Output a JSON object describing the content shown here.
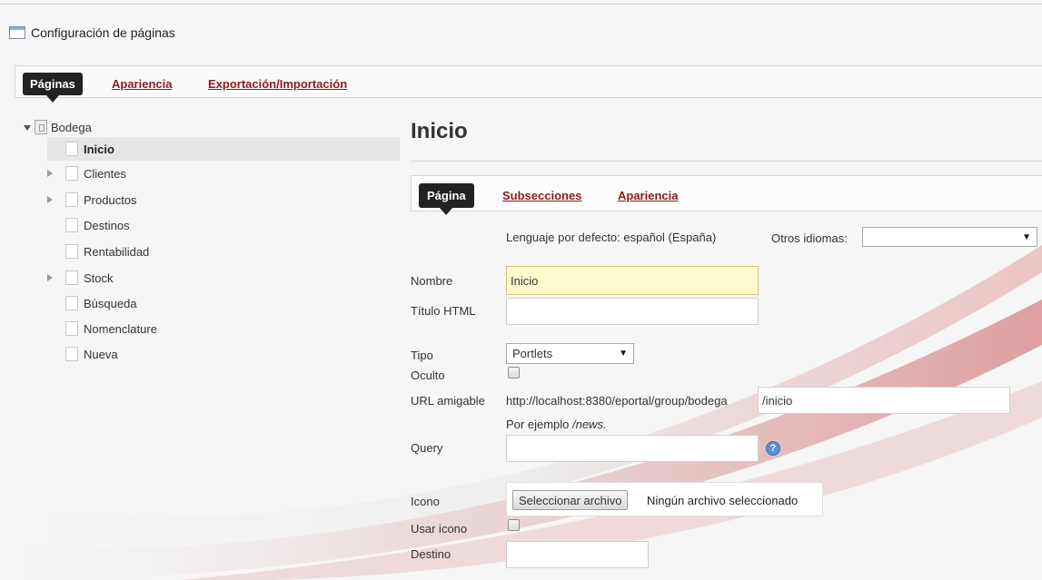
{
  "page": {
    "title": "Configuración de páginas"
  },
  "main_tabs": [
    {
      "label": "Páginas",
      "active": true
    },
    {
      "label": "Apariencia",
      "active": false
    },
    {
      "label": "Exportación/Importación",
      "active": false
    }
  ],
  "tree": {
    "root": "Bodega",
    "items": [
      {
        "label": "Inicio",
        "selected": true,
        "expandable": false
      },
      {
        "label": "Clientes",
        "expandable": true
      },
      {
        "label": "Productos",
        "expandable": true
      },
      {
        "label": "Destinos",
        "expandable": false
      },
      {
        "label": "Rentabilidad",
        "expandable": false
      },
      {
        "label": "Stock",
        "expandable": true
      },
      {
        "label": "Búsqueda",
        "expandable": false
      },
      {
        "label": "Nomenclature",
        "expandable": false
      },
      {
        "label": "Nueva",
        "expandable": false
      }
    ]
  },
  "detail": {
    "heading": "Inicio",
    "tabs": [
      {
        "label": "Página",
        "active": true
      },
      {
        "label": "Subsecciones",
        "active": false
      },
      {
        "label": "Apariencia",
        "active": false
      }
    ],
    "language": {
      "default_text": "Lenguaje por defecto: español (España)",
      "other_label": "Otros idiomas:",
      "other_value": ""
    },
    "form": {
      "nombre_label": "Nombre",
      "nombre_value": "Inicio",
      "titulo_label": "Título HTML",
      "titulo_value": "",
      "tipo_label": "Tipo",
      "tipo_value": "Portlets",
      "oculto_label": "Oculto",
      "oculto_checked": false,
      "url_label": "URL amigable",
      "url_prefix": "http://localhost:8380/eportal/group/bodega",
      "url_value": "/inicio",
      "url_hint_prefix": "Por ejemplo ",
      "url_hint_example": "/news.",
      "query_label": "Query",
      "query_value": "",
      "icono_label": "Icono",
      "file_button": "Seleccionar archivo",
      "file_status": "Ningún archivo seleccionado",
      "usar_icono_label": "Usar icono",
      "usar_icono_checked": false,
      "destino_label": "Destino",
      "destino_value": ""
    }
  },
  "colors": {
    "link": "#8b1c1c",
    "active_tab": "#222222",
    "focused_input": "#fffbd0"
  },
  "icons": {
    "window": "window-icon",
    "help": "help-icon",
    "document": "document-icon"
  }
}
